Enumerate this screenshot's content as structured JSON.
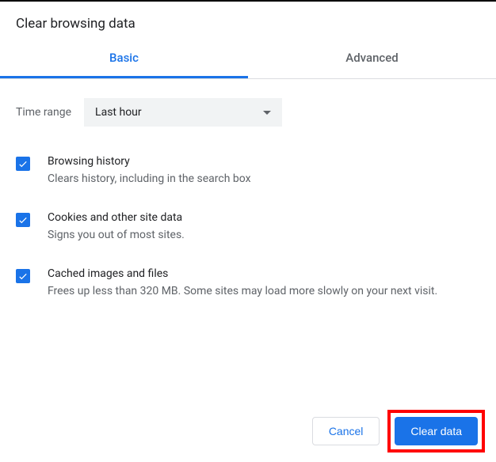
{
  "dialog": {
    "title": "Clear browsing data"
  },
  "tabs": {
    "basic": "Basic",
    "advanced": "Advanced"
  },
  "time_range": {
    "label": "Time range",
    "value": "Last hour"
  },
  "options": {
    "history": {
      "title": "Browsing history",
      "desc": "Clears history, including in the search box"
    },
    "cookies": {
      "title": "Cookies and other site data",
      "desc": "Signs you out of most sites."
    },
    "cache": {
      "title": "Cached images and files",
      "desc": "Frees up less than 320 MB. Some sites may load more slowly on your next visit."
    }
  },
  "buttons": {
    "cancel": "Cancel",
    "clear": "Clear data"
  }
}
